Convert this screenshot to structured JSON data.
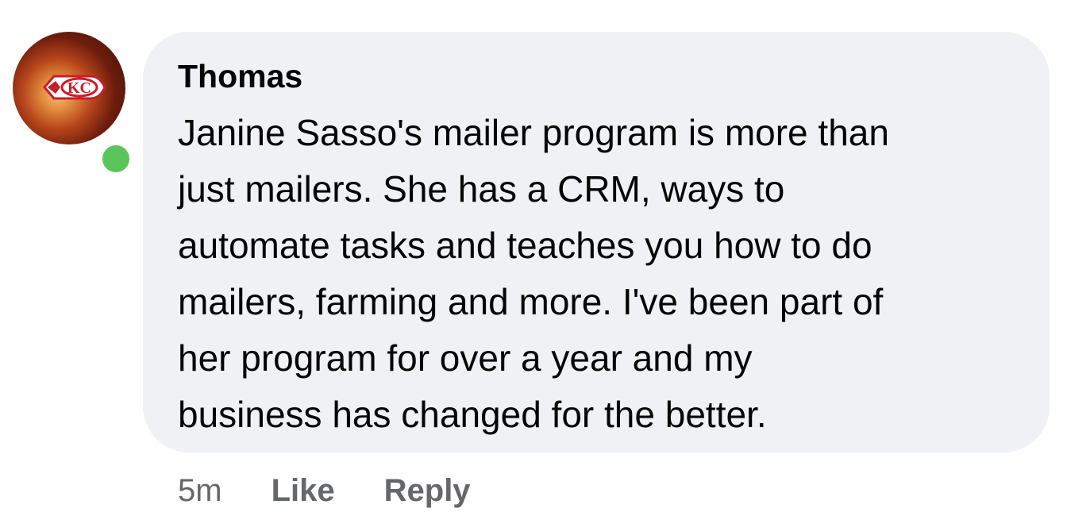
{
  "comment": {
    "author": "Thomas",
    "text": "Janine Sasso's mailer program is more than\njust mailers. She has a CRM, ways to\nautomate tasks and teaches you how to do\nmailers, farming and more. I've been part of\nher program for over a year and my\nbusiness has changed for the better.",
    "avatar_logo_text": "KC",
    "online": true,
    "online_color": "#5ac55a",
    "bubble_color": "#f0f1f4"
  },
  "actions": {
    "timestamp": "5m",
    "like_label": "Like",
    "reply_label": "Reply"
  }
}
